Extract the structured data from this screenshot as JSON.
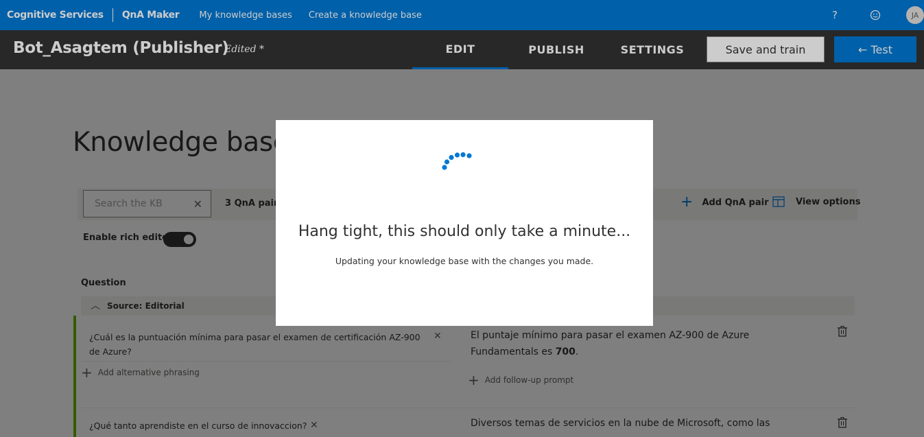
{
  "topnav": {
    "brand": "Cognitive Services",
    "product": "QnA Maker",
    "links": [
      "My knowledge bases",
      "Create a knowledge base"
    ],
    "help": "?",
    "avatar_initials": "JA"
  },
  "kbbar": {
    "title": "Bot_Asagtem (Publisher)",
    "status": "Edited *",
    "tabs": [
      "EDIT",
      "PUBLISH",
      "SETTINGS"
    ],
    "active_tab": "EDIT",
    "save_label": "Save and train",
    "test_label": "← Test"
  },
  "page": {
    "title": "Knowledge base",
    "search_placeholder": "Search the KB",
    "qna_count": "3 QnA pairs",
    "add_qna_label": "Add QnA pair",
    "view_options_label": "View options",
    "rich_editor_label": "Enable rich editor",
    "rich_editor_on": true,
    "question_header": "Question",
    "source_label": "Source: Editorial",
    "add_alt_label": "Add alternative phrasing",
    "add_followup_label": "Add follow-up prompt",
    "rows": [
      {
        "question": "¿Cuál es la puntuación mínima para pasar el examen de certificación AZ-900 de Azure?",
        "answer_prefix": "El puntaje mínimo para pasar el examen AZ-900 de Azure Fundamentals es ",
        "answer_bold": "700",
        "answer_suffix": "."
      },
      {
        "question": "¿Qué tanto aprendiste en el curso de innovaccion?",
        "answer": "Diversos temas de servicios en la nube de Microsoft, como las"
      }
    ]
  },
  "dialog": {
    "message": "Hang tight, this should only take a minute...",
    "submessage": "Updating your knowledge base with the changes you made."
  },
  "colors": {
    "brand_blue": "#0078d4",
    "dark_bar": "#333333",
    "editorial_green": "#6bb700"
  }
}
